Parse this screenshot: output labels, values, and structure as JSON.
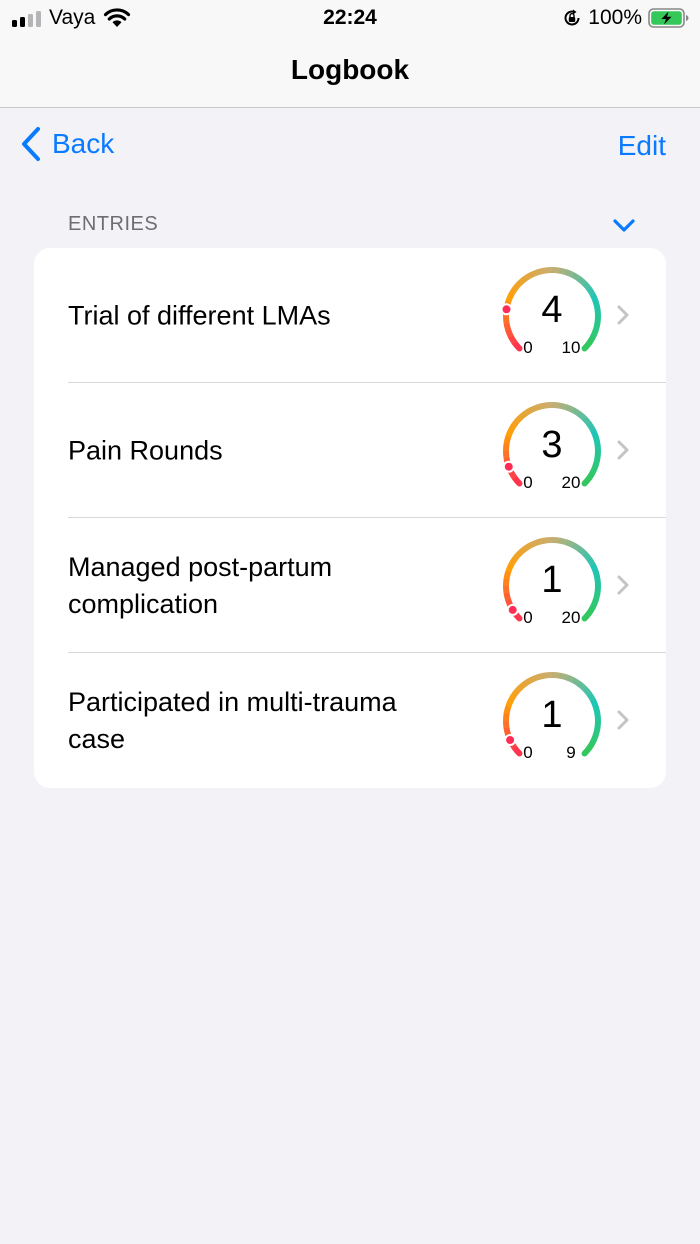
{
  "status_bar": {
    "carrier": "Vaya",
    "time": "22:24",
    "battery_percent": "100%",
    "signal_bars_filled": 2,
    "signal_bars_total": 4
  },
  "nav": {
    "title": "Logbook",
    "back_label": "Back",
    "edit_label": "Edit"
  },
  "section": {
    "header": "ENTRIES"
  },
  "colors": {
    "accent": "#0a7aff",
    "gauge_start": "#ff2d55",
    "gauge_mid": "#ff9f0a",
    "gauge_end": "#34c759"
  },
  "entries": [
    {
      "title": "Trial of different LMAs",
      "value": "4",
      "min": "0",
      "max": "10"
    },
    {
      "title": "Pain Rounds",
      "value": "3",
      "min": "0",
      "max": "20"
    },
    {
      "title": "Managed post-partum complication",
      "value": "1",
      "min": "0",
      "max": "20"
    },
    {
      "title": "Participated in multi-trauma case",
      "value": "1",
      "min": "0",
      "max": "9"
    }
  ]
}
